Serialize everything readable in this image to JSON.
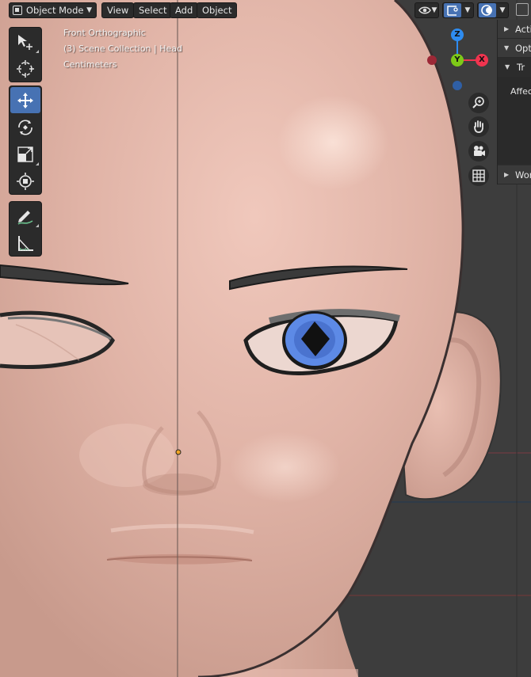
{
  "header": {
    "mode_label": "Object Mode",
    "menus": [
      "View",
      "Select",
      "Add",
      "Object"
    ]
  },
  "viewport_overlay": {
    "view_name": "Front Orthographic",
    "collection_info": "(3) Scene Collection | Head",
    "units": "Centimeters"
  },
  "toolbar": {
    "tools": [
      {
        "name": "select-box",
        "icon": "select-box-icon",
        "active": false
      },
      {
        "name": "cursor",
        "icon": "cursor-icon",
        "active": false
      },
      {
        "name": "move",
        "icon": "move-icon",
        "active": true
      },
      {
        "name": "rotate",
        "icon": "rotate-icon",
        "active": false
      },
      {
        "name": "scale",
        "icon": "scale-icon",
        "active": false
      },
      {
        "name": "transform",
        "icon": "transform-icon",
        "active": false
      },
      {
        "name": "annotate",
        "icon": "annotate-icon",
        "active": false
      },
      {
        "name": "measure",
        "icon": "measure-icon",
        "active": false
      }
    ]
  },
  "gizmo": {
    "axes": {
      "z": "Z",
      "y": "Y",
      "x": "X"
    },
    "colors": {
      "x": "#f0344f",
      "y": "#7eca18",
      "z": "#2e8cf0"
    }
  },
  "nav_buttons": [
    "zoom-icon",
    "hand-pan-icon",
    "camera-icon",
    "grid-icon"
  ],
  "properties_panel": {
    "sections": [
      "Acti",
      "Opt",
      "Wor"
    ],
    "subsection": "Tr",
    "field_label": "Affect"
  },
  "colors": {
    "accent": "#4772b3",
    "skin": "#dbb0a3",
    "iris": "#5d8ae6"
  }
}
